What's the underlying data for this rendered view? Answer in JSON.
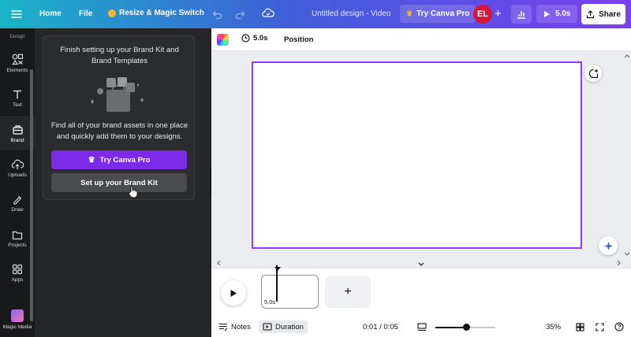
{
  "topbar": {
    "home": "Home",
    "file": "File",
    "resize": "Resize & Magic Switch",
    "doc_title": "Untitled design - Video",
    "try_pro": "Try Canva Pro",
    "avatar_initials": "EL",
    "play_duration": "5.0s",
    "share": "Share"
  },
  "rail": {
    "heading": "Design",
    "items": [
      {
        "label": "Elements",
        "icon": "elements-icon"
      },
      {
        "label": "Text",
        "icon": "text-icon"
      },
      {
        "label": "Brand",
        "icon": "brand-icon"
      },
      {
        "label": "Uploads",
        "icon": "uploads-icon"
      },
      {
        "label": "Draw",
        "icon": "draw-icon"
      },
      {
        "label": "Projects",
        "icon": "projects-icon"
      },
      {
        "label": "Apps",
        "icon": "apps-icon"
      },
      {
        "label": "Magic Media",
        "icon": "magic-media-icon"
      }
    ],
    "active": "Brand"
  },
  "brand_panel": {
    "title": "Finish setting up your Brand Kit and Brand Templates",
    "description": "Find all of your brand assets in one place and quickly add them to your designs.",
    "try_pro_button": "Try Canva Pro",
    "setup_button": "Set up your Brand Kit"
  },
  "context_toolbar": {
    "duration": "5.0s",
    "position": "Position"
  },
  "timeline": {
    "clip_duration": "5.0s",
    "add_label": "+"
  },
  "footer": {
    "notes": "Notes",
    "duration": "Duration",
    "time": "0:01 / 0:05",
    "zoom": "35%",
    "zoom_fraction": 0.52
  },
  "colors": {
    "accent": "#7d2ae8",
    "page_border": "#8b3dff",
    "avatar_bg": "#d4173b",
    "panel_bg": "#252627",
    "rail_bg": "#18191b"
  }
}
